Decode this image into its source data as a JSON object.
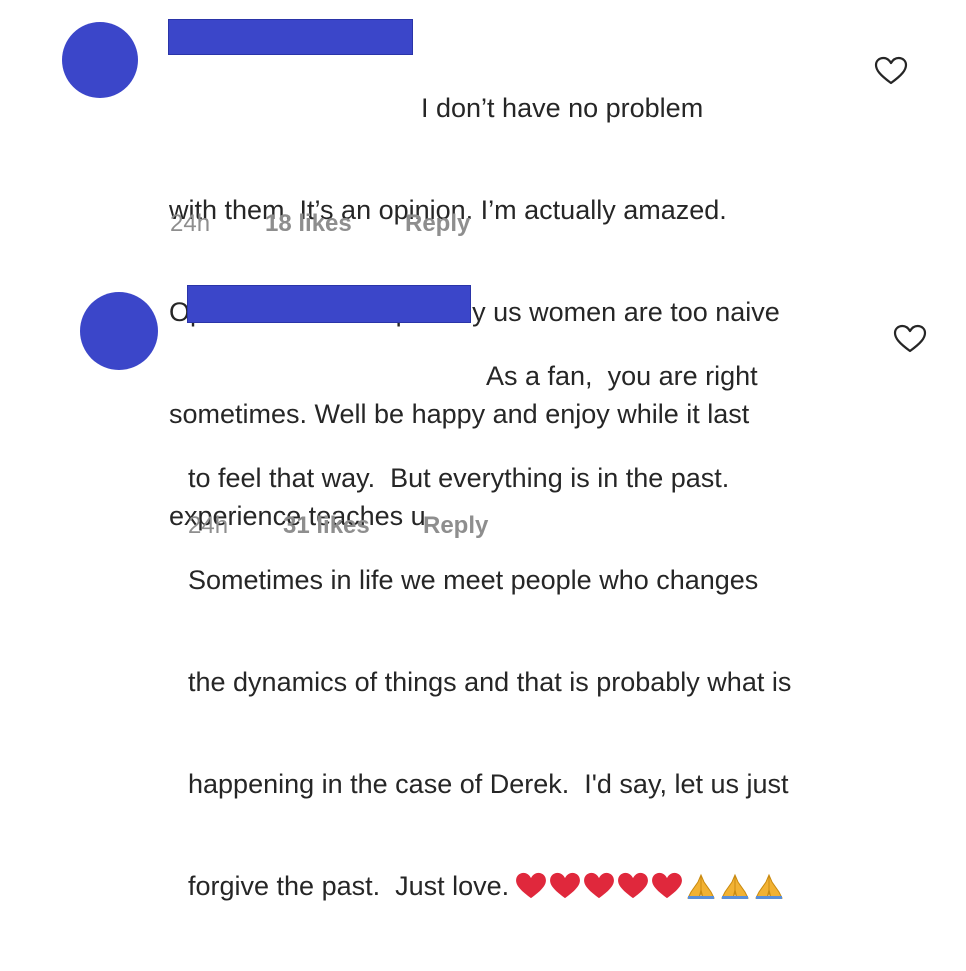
{
  "comments": [
    {
      "lines": [
        "I don’t have no problem",
        "with them. It’s an opinion. I’m actually amazed.",
        "Opinions matter especially us women are too naive",
        "sometimes. Well be happy and enjoy while it last",
        "experience teaches u"
      ],
      "time": "24h",
      "likes": "18 likes",
      "reply": "Reply"
    },
    {
      "lines": [
        "As a fan,  you are right",
        "to feel that way.  But everything is in the past.",
        "Sometimes in life we meet people who changes",
        "the dynamics of things and that is probably what is",
        "happening in the case of Derek.  I'd say, let us just",
        "forgive the past.  Just love."
      ],
      "emojis": [
        "red-heart",
        "red-heart",
        "red-heart",
        "red-heart",
        "red-heart",
        "folded-hands",
        "folded-hands",
        "folded-hands"
      ],
      "time": "24h",
      "likes": "31 likes",
      "reply": "Reply"
    }
  ],
  "colors": {
    "redaction": "#3b46c9",
    "text": "#262626",
    "meta": "#8e8e8e",
    "heart_outline": "#262626"
  }
}
